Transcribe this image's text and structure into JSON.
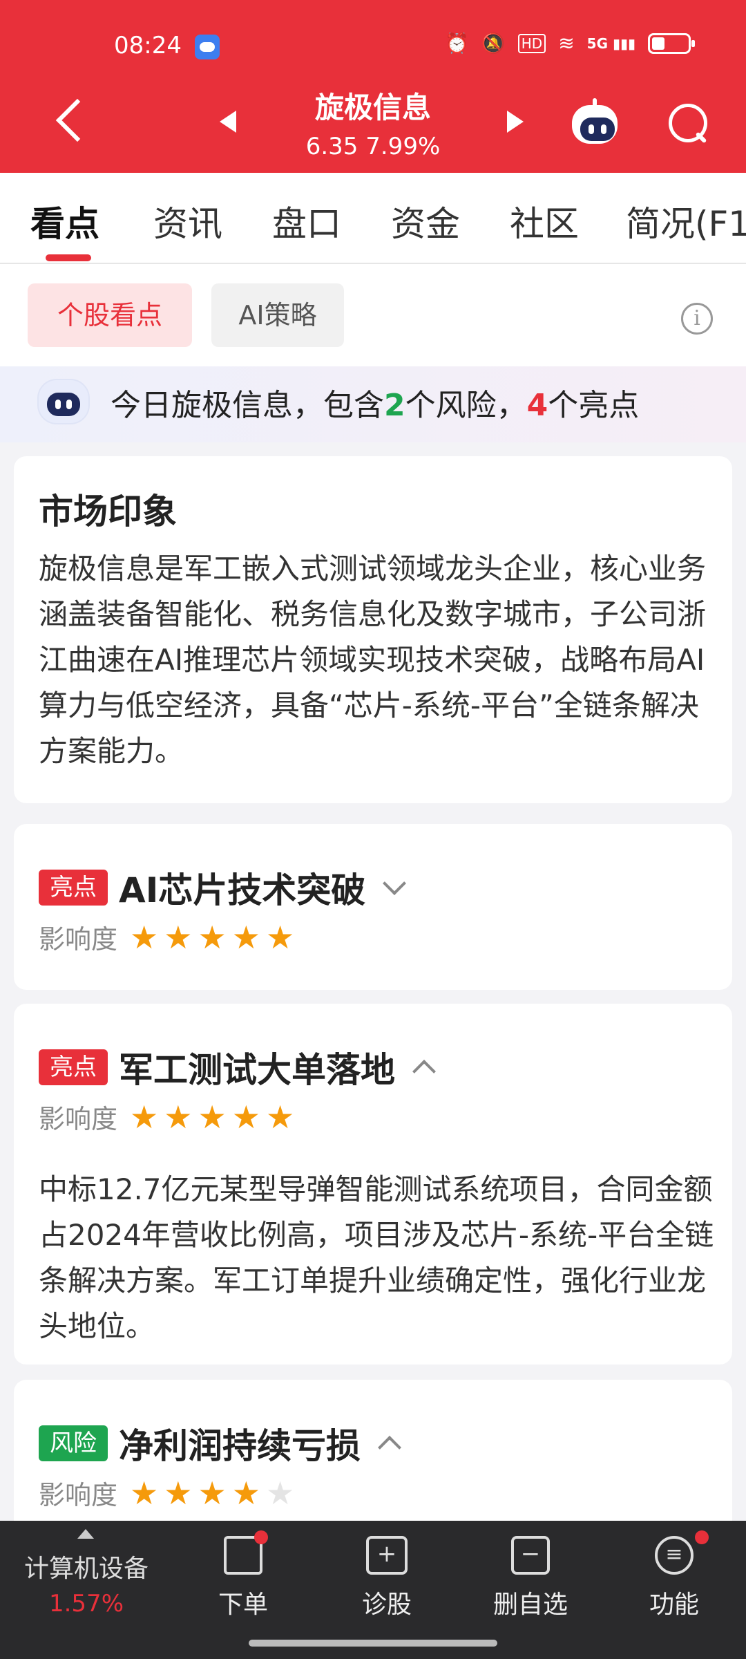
{
  "status_bar": {
    "time": "08:24",
    "icons": [
      "weather-icon",
      "alarm-icon",
      "mute-icon",
      "hd-icon",
      "wifi-icon",
      "5g-signal-icon",
      "battery-icon"
    ],
    "hd": "HD",
    "network": "5G"
  },
  "header": {
    "stock_name": "旋极信息",
    "price_line": "6.35 7.99%",
    "bg_color": "#e8303a"
  },
  "tabs": [
    "看点",
    "资讯",
    "盘口",
    "资金",
    "社区",
    "简况(F1"
  ],
  "subnav": {
    "active": "个股看点",
    "inactive": "AI策略",
    "info": "i"
  },
  "summary": {
    "prefix": "今日旋极信息，包含",
    "risk_count": "2",
    "mid": "个风险，",
    "highlight_count": "4",
    "suffix": "个亮点"
  },
  "market": {
    "title": "市场印象",
    "body": "旋极信息是军工嵌入式测试领域龙头企业，核心业务涵盖装备智能化、税务信息化及数字城市，子公司浙江曲速在AI推理芯片领域实现技术突破，战略布局AI算力与低空经济，具备“芯片-系统-平台”全链条解决方案能力。"
  },
  "points": [
    {
      "tag": "亮点",
      "title": "AI芯片技术突破",
      "impact_label": "影响度",
      "stars": 5,
      "expanded": false
    },
    {
      "tag": "亮点",
      "title": "军工测试大单落地",
      "impact_label": "影响度",
      "stars": 5,
      "expanded": true,
      "body": "中标12.7亿元某型导弹智能测试系统项目，合同金额占2024年营收比例高，项目涉及芯片-系统-平台全链条解决方案。军工订单提升业绩确定性，强化行业龙头地位。"
    },
    {
      "tag": "风险",
      "title": "净利润持续亏损",
      "impact_label": "影响度",
      "stars": 4,
      "expanded": true
    }
  ],
  "bottom_bar": {
    "sector_name": "计算机设备",
    "sector_change": "1.57%",
    "items": [
      "下单",
      "诊股",
      "删自选",
      "功能"
    ]
  },
  "colors": {
    "red": "#e8303a",
    "green": "#1ea550",
    "star": "#f59a0b"
  }
}
